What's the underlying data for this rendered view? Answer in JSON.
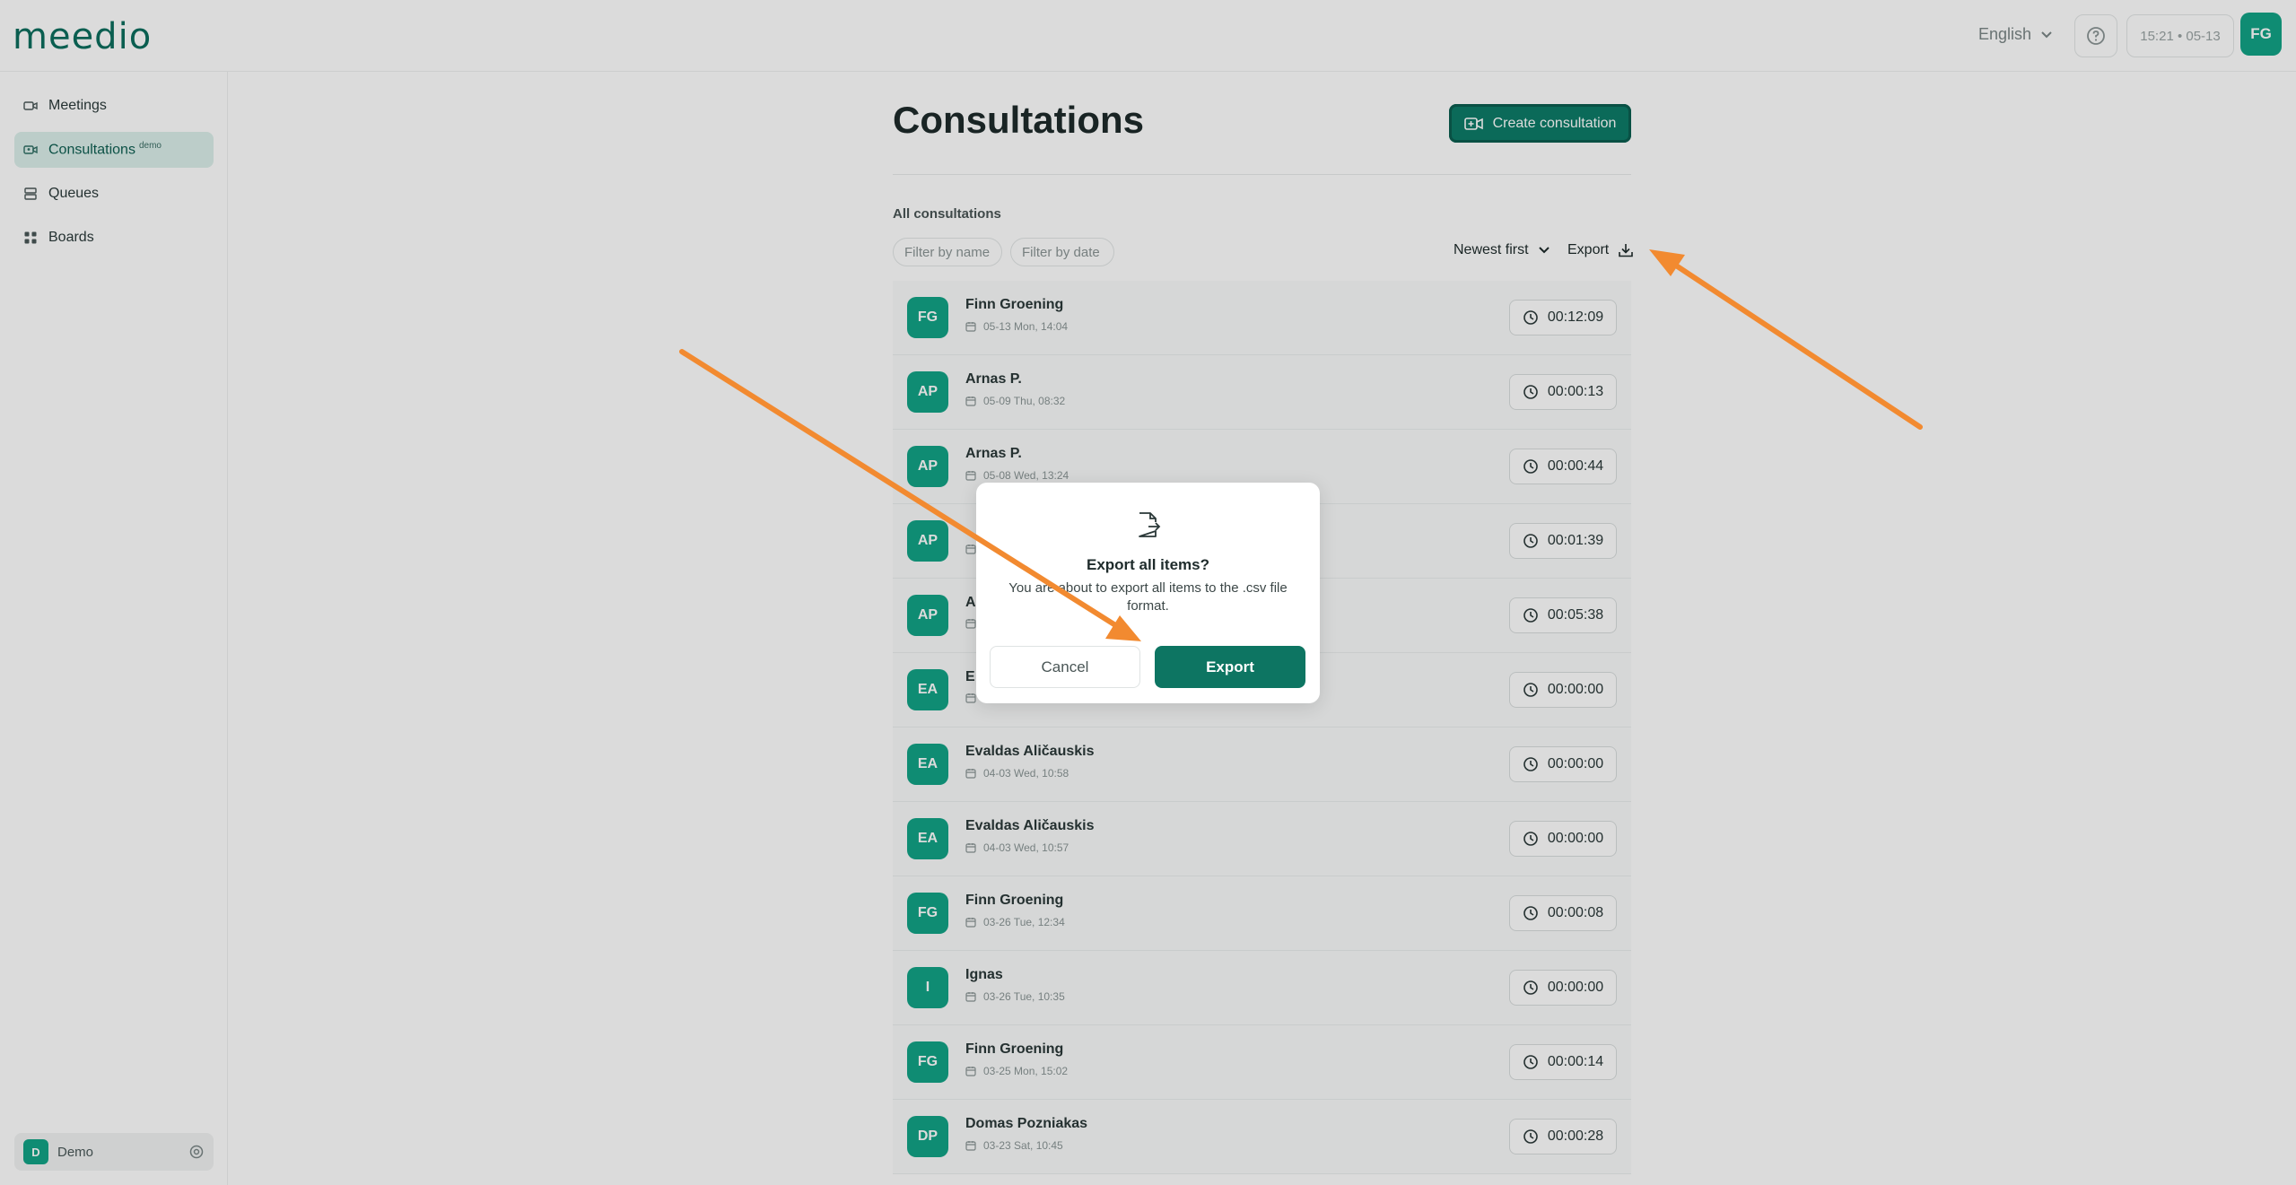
{
  "app": {
    "logo": "meedio",
    "accent": "#12a386",
    "button_dark": "#0d7562"
  },
  "header": {
    "language": "English",
    "clock": "15:21 • 05-13",
    "user_initials": "FG"
  },
  "sidebar": {
    "items": [
      {
        "label": "Meetings",
        "icon": "video-icon"
      },
      {
        "label": "Consultations",
        "badge": "demo",
        "icon": "video-user-icon",
        "active": true
      },
      {
        "label": "Queues",
        "icon": "queue-icon"
      },
      {
        "label": "Boards",
        "icon": "grid-icon"
      }
    ],
    "workspace": {
      "initial": "D",
      "name": "Demo"
    }
  },
  "main": {
    "title": "Consultations",
    "create_button": "Create consultation",
    "section_label": "All consultations",
    "filter_name_placeholder": "Filter by name",
    "filter_date_placeholder": "Filter by date",
    "sort_label": "Newest first",
    "export_label": "Export",
    "rows": [
      {
        "initials": "FG",
        "name": "Finn Groening",
        "date": "05-13 Mon, 14:04",
        "duration": "00:12:09"
      },
      {
        "initials": "AP",
        "name": "Arnas P.",
        "date": "05-09 Thu, 08:32",
        "duration": "00:00:13"
      },
      {
        "initials": "AP",
        "name": "Arnas P.",
        "date": "05-08 Wed, 13:24",
        "duration": "00:00:44"
      },
      {
        "initials": "AP",
        "name": "",
        "date": "",
        "duration": "00:01:39"
      },
      {
        "initials": "AP",
        "name": "A",
        "date": "",
        "duration": "00:05:38"
      },
      {
        "initials": "EA",
        "name": "E",
        "date": "",
        "duration": "00:00:00"
      },
      {
        "initials": "EA",
        "name": "Evaldas Aličauskis",
        "date": "04-03 Wed, 10:58",
        "duration": "00:00:00"
      },
      {
        "initials": "EA",
        "name": "Evaldas Aličauskis",
        "date": "04-03 Wed, 10:57",
        "duration": "00:00:00"
      },
      {
        "initials": "FG",
        "name": "Finn Groening",
        "date": "03-26 Tue, 12:34",
        "duration": "00:00:08"
      },
      {
        "initials": "I",
        "name": "Ignas",
        "date": "03-26 Tue, 10:35",
        "duration": "00:00:00"
      },
      {
        "initials": "FG",
        "name": "Finn Groening",
        "date": "03-25 Mon, 15:02",
        "duration": "00:00:14"
      },
      {
        "initials": "DP",
        "name": "Domas Pozniakas",
        "date": "03-23 Sat, 10:45",
        "duration": "00:00:28"
      }
    ]
  },
  "modal": {
    "title": "Export all items?",
    "text": "You are about to export all items to the .csv file format.",
    "cancel": "Cancel",
    "confirm": "Export"
  },
  "annotation": {
    "arrow_color": "#f28a30"
  }
}
